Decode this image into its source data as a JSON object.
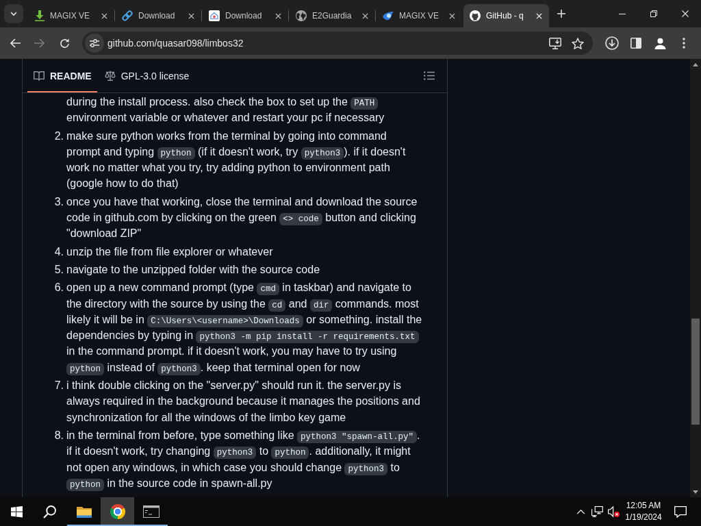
{
  "browser": {
    "tabs": [
      {
        "title": "MAGIX VE",
        "selected": false
      },
      {
        "title": "Download",
        "selected": false
      },
      {
        "title": "Download",
        "selected": false
      },
      {
        "title": "E2Guardia",
        "selected": false
      },
      {
        "title": "MAGIX VE",
        "selected": false
      },
      {
        "title": "GitHub - q",
        "selected": true
      }
    ],
    "navigation": {
      "back": {
        "disabled": false
      },
      "forward": {
        "disabled": true
      }
    },
    "address": {
      "url": "github.com/quasar098/limbos32"
    }
  },
  "readme": {
    "tabs": [
      {
        "label": "README",
        "selected": true
      },
      {
        "label": "GPL-3.0 license",
        "selected": false
      }
    ],
    "items": [
      {
        "lines": [
          [
            {
              "kind": "text",
              "text": "during the install process. also check the box to set up the "
            },
            {
              "kind": "code",
              "text": "PATH"
            }
          ],
          [
            {
              "kind": "text",
              "text": "environment variable or whatever and restart your pc if necessary"
            }
          ]
        ]
      },
      {
        "number": "2.",
        "lines": [
          [
            {
              "kind": "text",
              "text": "make sure python works from the terminal by going into command"
            }
          ],
          [
            {
              "kind": "text",
              "text": "prompt and typing "
            },
            {
              "kind": "code",
              "text": "python"
            },
            {
              "kind": "text",
              "text": " (if it doesn't work, try "
            },
            {
              "kind": "code",
              "text": "python3"
            },
            {
              "kind": "text",
              "text": "). if it doesn't"
            }
          ],
          [
            {
              "kind": "text",
              "text": "work no matter what you try, try adding python to environment path"
            }
          ],
          [
            {
              "kind": "text",
              "text": "(google how to do that)"
            }
          ]
        ]
      },
      {
        "number": "3.",
        "lines": [
          [
            {
              "kind": "text",
              "text": "once you have that working, close the terminal and download the source"
            }
          ],
          [
            {
              "kind": "text",
              "text": "code in github.com by clicking on the green "
            },
            {
              "kind": "code",
              "text": "<> code"
            },
            {
              "kind": "text",
              "text": " button and clicking"
            }
          ],
          [
            {
              "kind": "text",
              "text": "\"download ZIP\""
            }
          ]
        ]
      },
      {
        "number": "4.",
        "lines": [
          [
            {
              "kind": "text",
              "text": "unzip the file from file explorer or whatever"
            }
          ]
        ]
      },
      {
        "number": "5.",
        "lines": [
          [
            {
              "kind": "text",
              "text": "navigate to the unzipped folder with the source code"
            }
          ]
        ]
      },
      {
        "number": "6.",
        "lines": [
          [
            {
              "kind": "text",
              "text": "open up a new command prompt (type "
            },
            {
              "kind": "code",
              "text": "cmd"
            },
            {
              "kind": "text",
              "text": " in taskbar) and navigate to"
            }
          ],
          [
            {
              "kind": "text",
              "text": "the directory with the source by using the "
            },
            {
              "kind": "code",
              "text": "cd"
            },
            {
              "kind": "text",
              "text": " and "
            },
            {
              "kind": "code",
              "text": "dir"
            },
            {
              "kind": "text",
              "text": " commands. most"
            }
          ],
          [
            {
              "kind": "text",
              "text": "likely it will be in "
            },
            {
              "kind": "code",
              "text": "C:\\Users\\<username>\\Downloads"
            },
            {
              "kind": "text",
              "text": " or something. install the"
            }
          ],
          [
            {
              "kind": "text",
              "text": "dependencies by typing in "
            },
            {
              "kind": "code",
              "text": "python3 -m pip install -r requirements.txt"
            }
          ],
          [
            {
              "kind": "text",
              "text": "in the command prompt. if it doesn't work, you may have to try using"
            }
          ],
          [
            {
              "kind": "code",
              "text": "python"
            },
            {
              "kind": "text",
              "text": " instead of "
            },
            {
              "kind": "code",
              "text": "python3"
            },
            {
              "kind": "text",
              "text": ". keep that terminal open for now"
            }
          ]
        ]
      },
      {
        "number": "7.",
        "lines": [
          [
            {
              "kind": "text",
              "text": "i think double clicking on the \"server.py\" should run it. the server.py is"
            }
          ],
          [
            {
              "kind": "text",
              "text": "always required in the background because it manages the positions and"
            }
          ],
          [
            {
              "kind": "text",
              "text": "synchronization for all the windows of the limbo key game"
            }
          ]
        ]
      },
      {
        "number": "8.",
        "lines": [
          [
            {
              "kind": "text",
              "text": "in the terminal from before, type something like "
            },
            {
              "kind": "code",
              "text": "python3 \"spawn-all.py\""
            },
            {
              "kind": "text",
              "text": "."
            }
          ],
          [
            {
              "kind": "text",
              "text": "if it doesn't work, try changing "
            },
            {
              "kind": "code",
              "text": "python3"
            },
            {
              "kind": "text",
              "text": " to "
            },
            {
              "kind": "code",
              "text": "python"
            },
            {
              "kind": "text",
              "text": ". additionally, it might"
            }
          ],
          [
            {
              "kind": "text",
              "text": "not open any windows, in which case you should change "
            },
            {
              "kind": "code",
              "text": "python3"
            },
            {
              "kind": "text",
              "text": " to"
            }
          ],
          [
            {
              "kind": "code",
              "text": "python"
            },
            {
              "kind": "text",
              "text": " in the source code in spawn-all.py"
            }
          ]
        ]
      }
    ]
  },
  "taskbar": {
    "apps": [
      {
        "running": true,
        "selected": false
      },
      {
        "running": true,
        "selected": true
      },
      {
        "running": true,
        "selected": false
      }
    ],
    "tray": {
      "muted": true
    },
    "clock": {
      "time": "12:05 AM",
      "date": "1/19/2024"
    }
  }
}
